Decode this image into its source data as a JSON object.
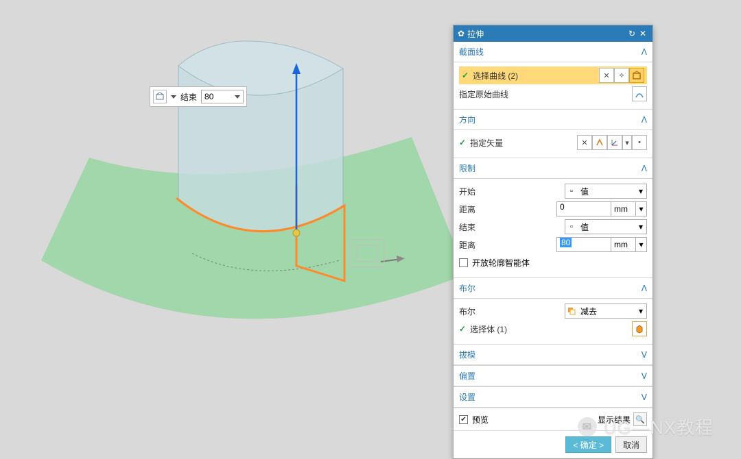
{
  "floating": {
    "label": "结束",
    "value": "80"
  },
  "dialog": {
    "title": "拉伸",
    "sections": {
      "section_curve": {
        "title": "截面线",
        "select_curve": "选择曲线 (2)",
        "specify_orig": "指定原始曲线"
      },
      "direction": {
        "title": "方向",
        "specify_vector": "指定矢量"
      },
      "limits": {
        "title": "限制",
        "start_label": "开始",
        "start_type": "值",
        "start_dist_label": "距离",
        "start_dist_value": "0",
        "start_unit": "mm",
        "end_label": "结束",
        "end_type": "值",
        "end_dist_label": "距离",
        "end_dist_value": "80",
        "end_unit": "mm",
        "open_profile": "开放轮廓智能体"
      },
      "boolean": {
        "title": "布尔",
        "bool_label": "布尔",
        "bool_value": "减去",
        "select_body": "选择体 (1)"
      },
      "draft": {
        "title": "拔模"
      },
      "offset": {
        "title": "偏置"
      },
      "settings": {
        "title": "设置"
      }
    },
    "preview": {
      "label": "预览",
      "show_result": "显示结果"
    },
    "buttons": {
      "ok": "< 确定 >",
      "cancel": "取消"
    }
  },
  "watermark": {
    "text": "UG—NX教程"
  }
}
